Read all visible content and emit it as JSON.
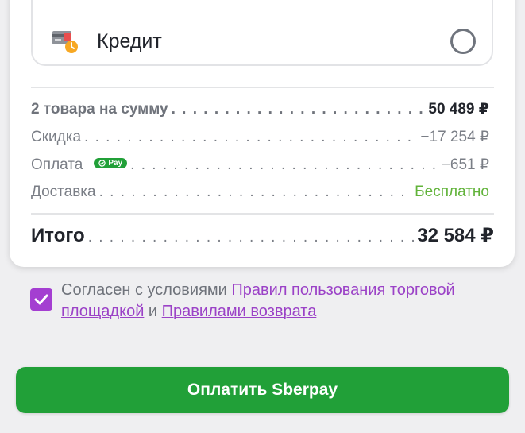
{
  "payment_options": {
    "credit_label": "Кредит"
  },
  "summary": {
    "items_label": "2 товара на сумму",
    "items_value": "50 489 ₽",
    "discount_label": "Скидка",
    "discount_value": "−17 254 ₽",
    "payment_label": "Оплата",
    "payment_badge": "Pay",
    "payment_value": "−651 ₽",
    "delivery_label": "Доставка",
    "delivery_value": "Бесплатно",
    "total_label": "Итого",
    "total_value": "32 584 ₽"
  },
  "agreement": {
    "checked": true,
    "prefix": "Согласен с условиями ",
    "link_rules": "Правил пользования торговой площадкой",
    "conjunction": " и ",
    "link_returns": "Правилами возврата"
  },
  "actions": {
    "pay_button_label": "Оплатить Sberpay"
  },
  "colors": {
    "brand_green": "#21a038",
    "free_delivery_green": "#61b33a",
    "link_purple": "#9b42c7",
    "checkbox_purple": "#a43ed1"
  }
}
